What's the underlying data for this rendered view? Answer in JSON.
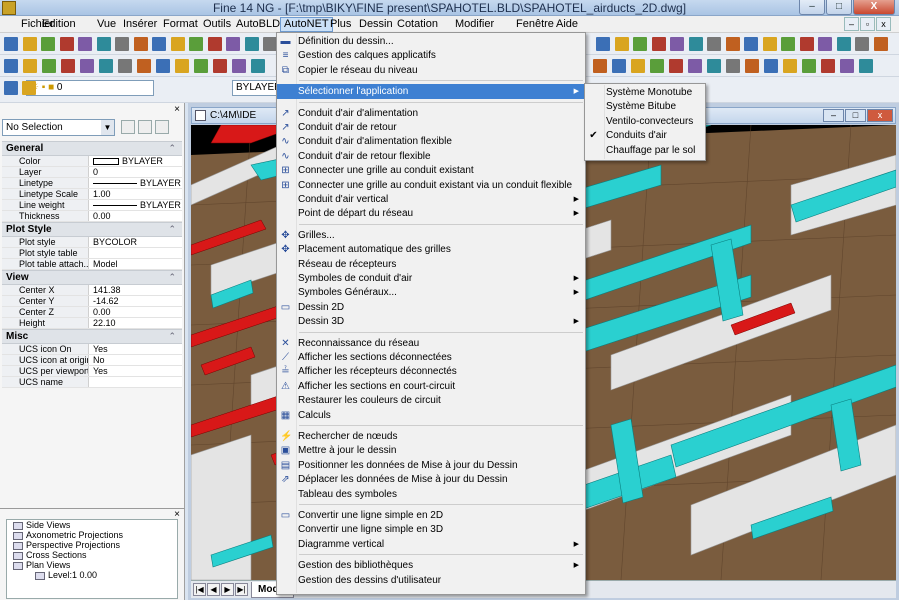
{
  "window": {
    "title": "Fine 14 NG - [F:\\tmp\\BIKY\\FINE present\\SPAHOTEL.BLD\\SPAHOTEL_airducts_2D.dwg]",
    "minimize": "–",
    "maximize": "□",
    "close": "X"
  },
  "menubar": {
    "items": [
      "Fichier",
      "Edition",
      "Vue",
      "Insérer",
      "Format",
      "Outils",
      "AutoBLD",
      "AutoNET",
      "Plus",
      "Dessin",
      "Cotation",
      "Modifier",
      "Fenêtre",
      "Aide"
    ],
    "active": "AutoNET"
  },
  "toolbar": {
    "layer_value": "0",
    "bylayer_value": "BYLAYER"
  },
  "properties": {
    "selection": "No Selection",
    "sections": [
      {
        "name": "General",
        "rows": [
          {
            "key": "Color",
            "value": "BYLAYER",
            "swatch": "color"
          },
          {
            "key": "Layer",
            "value": "0"
          },
          {
            "key": "Linetype",
            "value": "BYLAYER",
            "swatch": "line"
          },
          {
            "key": "Linetype Scale",
            "value": "1.00"
          },
          {
            "key": "Line weight",
            "value": "BYLAYER",
            "swatch": "line"
          },
          {
            "key": "Thickness",
            "value": "0.00"
          }
        ]
      },
      {
        "name": "Plot Style",
        "rows": [
          {
            "key": "Plot style",
            "value": "BYCOLOR"
          },
          {
            "key": "Plot style table",
            "value": ""
          },
          {
            "key": "Plot table attach...",
            "value": "Model"
          }
        ]
      },
      {
        "name": "View",
        "rows": [
          {
            "key": "Center X",
            "value": "141.38"
          },
          {
            "key": "Center Y",
            "value": "-14.62"
          },
          {
            "key": "Center Z",
            "value": "0.00"
          },
          {
            "key": "Height",
            "value": "22.10"
          }
        ]
      },
      {
        "name": "Misc",
        "rows": [
          {
            "key": "UCS icon On",
            "value": "Yes"
          },
          {
            "key": "UCS icon at origin",
            "value": "No"
          },
          {
            "key": "UCS per viewport",
            "value": "Yes"
          },
          {
            "key": "UCS name",
            "value": ""
          }
        ]
      }
    ]
  },
  "tree": {
    "items": [
      {
        "label": "Side Views",
        "indent": 0
      },
      {
        "label": "Axonometric Projections",
        "indent": 0
      },
      {
        "label": "Perspective Projections",
        "indent": 0
      },
      {
        "label": "Cross Sections",
        "indent": 0
      },
      {
        "label": "Plan Views",
        "indent": 0
      },
      {
        "label": "Level:1  0.00",
        "indent": 1
      }
    ]
  },
  "drawing": {
    "doc_title": "C:\\4M\\IDE",
    "tab_model": "Model"
  },
  "autonet_menu": {
    "items": [
      {
        "label": "Définition du dessin...",
        "icon": "▬"
      },
      {
        "label": "Gestion des calques applicatifs",
        "icon": "≡"
      },
      {
        "label": "Copier le réseau du niveau",
        "icon": "⧉"
      },
      {
        "sep": true
      },
      {
        "label": "Sélectionner l'application",
        "submenu": true,
        "highlight": true
      },
      {
        "sep": true
      },
      {
        "label": "Conduit d'air d'alimentation",
        "icon": "↗"
      },
      {
        "label": "Conduit d'air de retour",
        "icon": "↗"
      },
      {
        "label": "Conduit d'air d'alimentation flexible",
        "icon": "∿"
      },
      {
        "label": "Conduit d'air de retour flexible",
        "icon": "∿"
      },
      {
        "label": "Connecter une grille au conduit existant",
        "icon": "⊞"
      },
      {
        "label": "Connecter une grille au conduit existant via un conduit flexible",
        "icon": "⊞"
      },
      {
        "label": "Conduit d'air vertical",
        "submenu": true
      },
      {
        "label": "Point de départ du réseau",
        "submenu": true
      },
      {
        "sep": true
      },
      {
        "label": "Grilles...",
        "icon": "✥"
      },
      {
        "label": "Placement automatique des grilles",
        "icon": "✥"
      },
      {
        "label": "Réseau de récepteurs"
      },
      {
        "label": "Symboles de conduit d'air",
        "submenu": true
      },
      {
        "label": "Symboles Généraux...",
        "submenu": true
      },
      {
        "label": "Dessin 2D",
        "icon": "▭"
      },
      {
        "label": "Dessin 3D",
        "submenu": true
      },
      {
        "sep": true
      },
      {
        "label": "Reconnaissance du réseau",
        "icon": "✕"
      },
      {
        "label": "Afficher les sections déconnectées",
        "icon": "⟋"
      },
      {
        "label": "Afficher les récepteurs déconnectés",
        "icon": "≟"
      },
      {
        "label": "Afficher les sections en court-circuit",
        "icon": "⚠"
      },
      {
        "label": "Restaurer les couleurs de circuit"
      },
      {
        "label": "Calculs",
        "icon": "▦"
      },
      {
        "sep": true
      },
      {
        "label": "Rechercher de nœuds",
        "icon": "⚡"
      },
      {
        "label": "Mettre à jour le dessin",
        "icon": "▣"
      },
      {
        "label": "Positionner les données de Mise à jour du Dessin",
        "icon": "▤"
      },
      {
        "label": "Déplacer les données de Mise à jour du Dessin",
        "icon": "⇗"
      },
      {
        "label": "Tableau des symboles"
      },
      {
        "sep": true
      },
      {
        "label": "Convertir une ligne simple en 2D",
        "icon": "▭"
      },
      {
        "label": "Convertir une ligne simple en 3D"
      },
      {
        "label": "Diagramme vertical",
        "submenu": true
      },
      {
        "sep": true
      },
      {
        "label": "Gestion des bibliothèques",
        "submenu": true
      },
      {
        "label": "Gestion des dessins d'utilisateur"
      }
    ]
  },
  "application_submenu": {
    "items": [
      {
        "label": "Système Monotube",
        "checked": false
      },
      {
        "label": "Système Bitube",
        "checked": false
      },
      {
        "label": "Ventilo-convecteurs",
        "checked": false
      },
      {
        "label": "Conduits d'air",
        "checked": true
      },
      {
        "label": "Chauffage par le sol",
        "checked": false
      }
    ]
  },
  "colors": {
    "duct_cyan": "#2ad0d0",
    "duct_red": "#d81818",
    "menu_highlight": "#3e80d2",
    "floor_brown": "#8a6a4a"
  }
}
